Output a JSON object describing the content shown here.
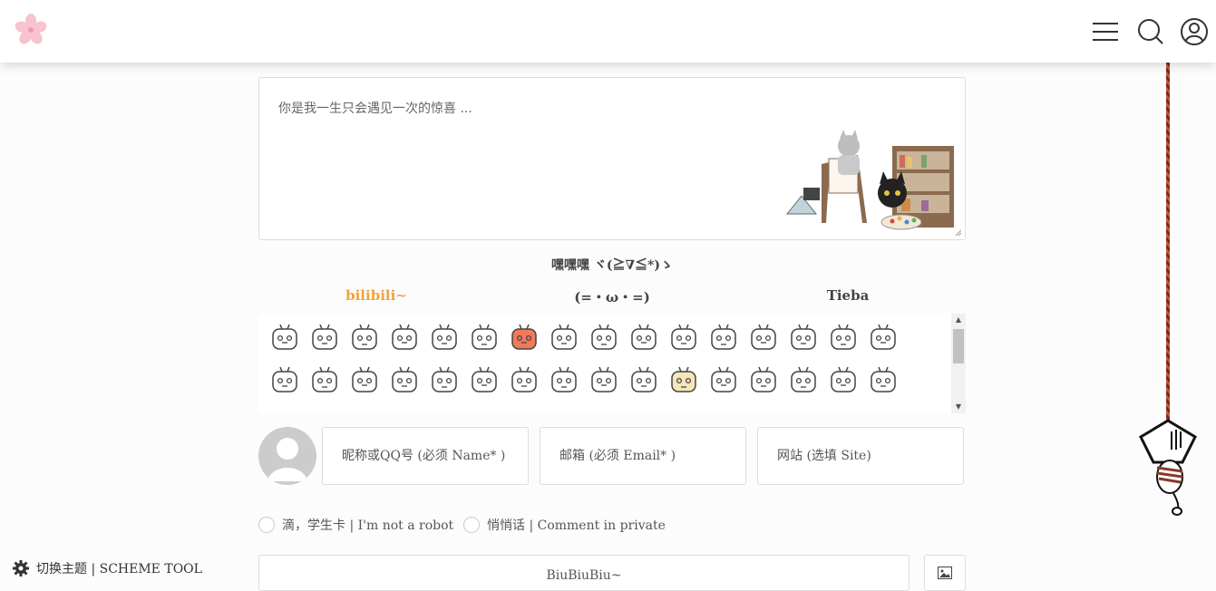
{
  "header": {
    "logo_icon": "sakura-flower-icon",
    "menu_icon": "hamburger-menu-icon",
    "search_icon": "search-icon",
    "user_icon": "user-circle-icon"
  },
  "comment": {
    "textarea_placeholder": "你是我一生只会遇见一次的惊喜 ...",
    "kaomoji_toggle": "嘿嘿嘿 ヾ(≧∇≦*)ゝ",
    "emoji_tabs": [
      "bilibili~",
      "(=・ω・=)",
      "Tieba"
    ],
    "active_tab": 0,
    "name_placeholder": "昵称或QQ号 (必须 Name* )",
    "email_placeholder": "邮箱 (必须 Email* )",
    "site_placeholder": "网站 (选填 Site)",
    "robot_check": "滴，学生卡 | I'm not a robot",
    "private_check": "悄悄话 | Comment in private",
    "submit_label": "BiuBiuBiu~",
    "image_icon": "image-upload-icon"
  },
  "footer": {
    "scheme_tool": "切换主题 | SCHEME TOOL",
    "scheme_icon": "gear-icon"
  },
  "colors": {
    "active_tab": "#f1a23a",
    "rope": "#7a2a1f"
  }
}
